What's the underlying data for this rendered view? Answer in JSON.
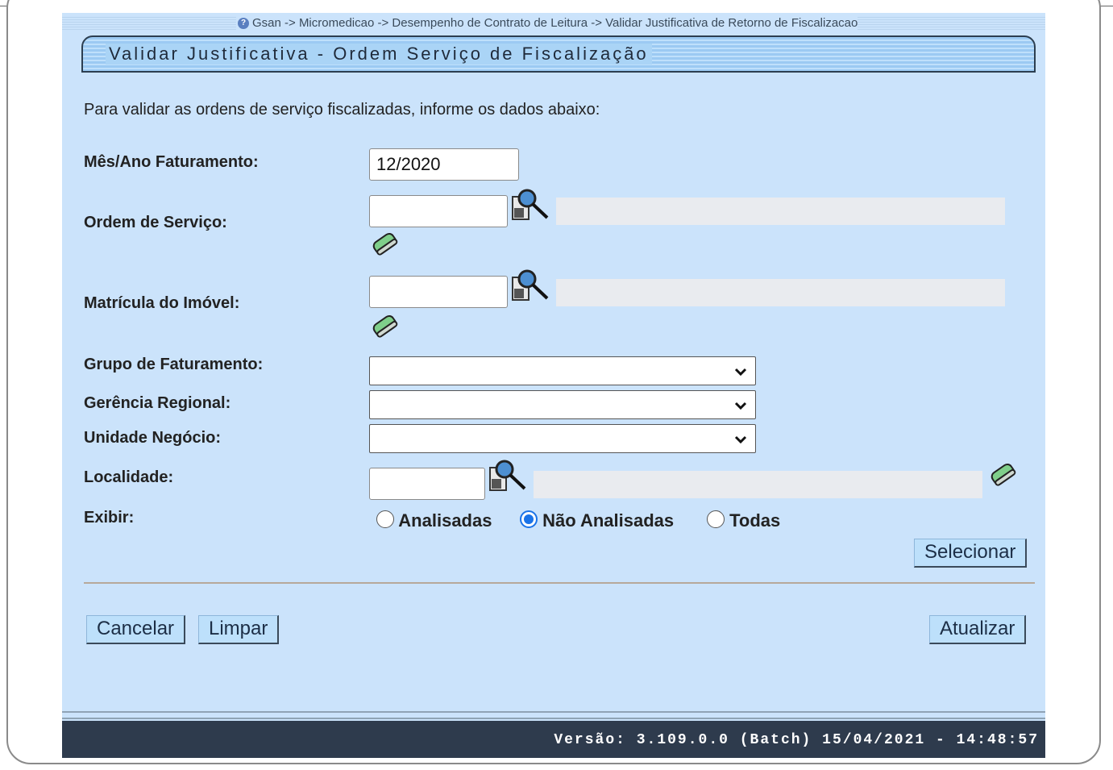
{
  "breadcrumb": "Gsan -> Micromedicao -> Desempenho de Contrato de Leitura -> Validar Justificativa de Retorno de Fiscalizacao",
  "title": "Validar Justificativa - Ordem Serviço de Fiscalização",
  "instruction": "Para validar as ordens de serviço fiscalizadas, informe os dados abaixo:",
  "fields": {
    "mes_ano_label": "Mês/Ano Faturamento:",
    "mes_ano_value": "12/2020",
    "ordem_servico_label": "Ordem de Serviço:",
    "ordem_servico_value": "",
    "matricula_label": "Matrícula do Imóvel:",
    "matricula_value": "",
    "grupo_label": "Grupo de Faturamento:",
    "grupo_value": "",
    "gerencia_label": "Gerência Regional:",
    "gerencia_value": "",
    "unidade_label": "Unidade Negócio:",
    "unidade_value": "",
    "localidade_label": "Localidade:",
    "localidade_value": "",
    "exibir_label": "Exibir:"
  },
  "exibir_options": [
    {
      "label": "Analisadas",
      "checked": false
    },
    {
      "label": "Não Analisadas",
      "checked": true
    },
    {
      "label": "Todas",
      "checked": false
    }
  ],
  "buttons": {
    "selecionar": "Selecionar",
    "cancelar": "Cancelar",
    "limpar": "Limpar",
    "atualizar": "Atualizar"
  },
  "footer": "Versão: 3.109.0.0 (Batch) 15/04/2021 - 14:48:57",
  "icons": {
    "lookup": "magnifier-lookup-icon",
    "clear": "eraser-icon",
    "help": "help-icon",
    "dropdown": "chevron-down-icon"
  },
  "colors": {
    "panel": "#cbe3fb",
    "footer": "#2e3b4d",
    "button": "#bde0fb",
    "radio_accent": "#1a73e8"
  }
}
